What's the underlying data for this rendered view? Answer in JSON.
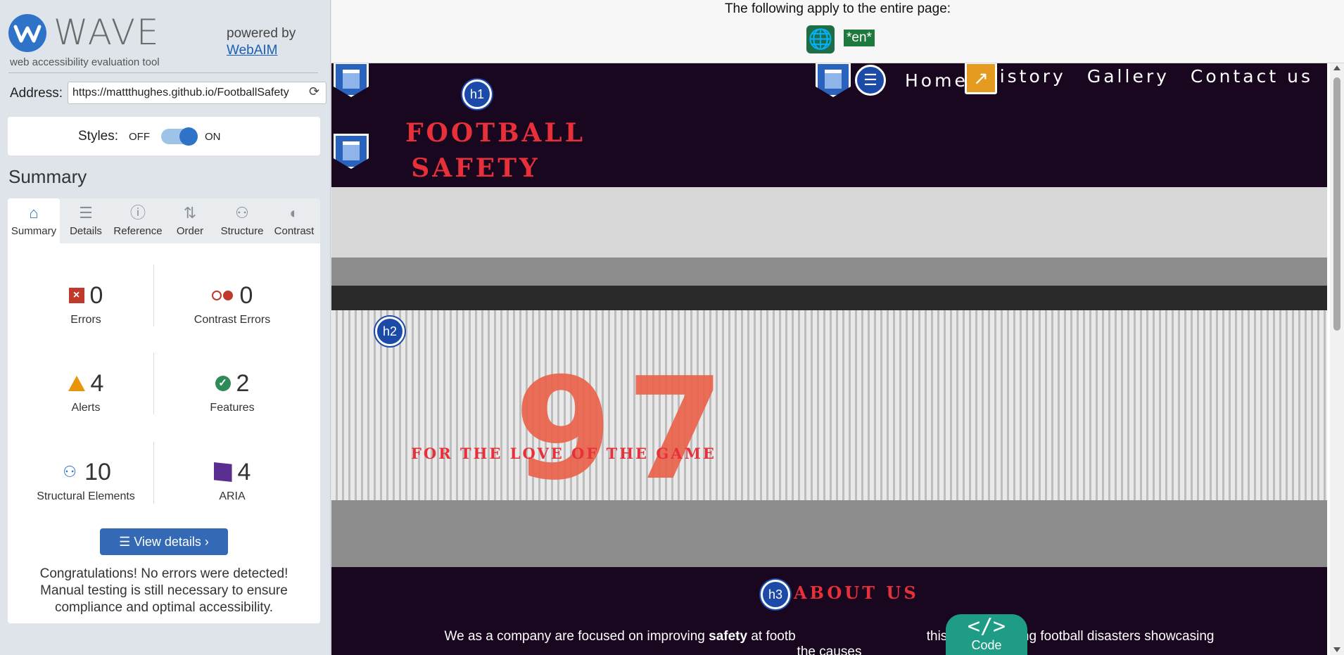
{
  "sidebar": {
    "logo_word": "WAVE",
    "logo_tagline": "web accessibility evaluation tool",
    "powered_by": "powered by",
    "powered_link": "WebAIM",
    "address_label": "Address:",
    "address_value": "https://mattthughes.github.io/FootballSafety",
    "styles_label": "Styles:",
    "styles_off": "OFF",
    "styles_on": "ON",
    "styles_enabled": true,
    "summary_heading": "Summary",
    "tabs": [
      {
        "label": "Summary",
        "icon": "home-icon",
        "glyph": "⌂"
      },
      {
        "label": "Details",
        "icon": "list-icon",
        "glyph": "☰"
      },
      {
        "label": "Reference",
        "icon": "info-icon",
        "glyph": "ⓘ"
      },
      {
        "label": "Order",
        "icon": "order-icon",
        "glyph": "⇅"
      },
      {
        "label": "Structure",
        "icon": "structure-icon",
        "glyph": "⚇"
      },
      {
        "label": "Contrast",
        "icon": "contrast-icon",
        "glyph": "◐"
      }
    ],
    "stats": {
      "errors": {
        "value": "0",
        "label": "Errors"
      },
      "contrast_errors": {
        "value": "0",
        "label": "Contrast Errors"
      },
      "alerts": {
        "value": "4",
        "label": "Alerts"
      },
      "features": {
        "value": "2",
        "label": "Features"
      },
      "structural": {
        "value": "10",
        "label": "Structural Elements"
      },
      "aria": {
        "value": "4",
        "label": "ARIA"
      }
    },
    "view_details": "View details ›",
    "congrats": "Congratulations! No errors were detected! Manual testing is still necessary to ensure compliance and optimal accessibility."
  },
  "main": {
    "notice": "The following apply to the entire page:",
    "lang_badge": "*en*",
    "site": {
      "brand": "FOOTBALL SAFETY",
      "nav": [
        "Home",
        "History",
        "Gallery",
        "Contact us"
      ],
      "hero_tagline": "FOR THE LOVE OF THE GAME",
      "hero_number": "97",
      "about_title": "ABOUT US",
      "about_text_pre": "We as a company are focused on improving ",
      "about_text_bold": "safety",
      "about_text_post": " at footb",
      "about_text_tail": "this by highlighting football disasters showcasing the causes"
    },
    "wave_labels": {
      "h1": "h1",
      "h2": "h2",
      "h3": "h3"
    },
    "code_label": "Code",
    "code_glyph": "</>"
  },
  "colors": {
    "wave_blue": "#2f73c9",
    "site_bg": "#18071f",
    "brand_red": "#e8303a",
    "code_teal": "#1e9c86"
  }
}
